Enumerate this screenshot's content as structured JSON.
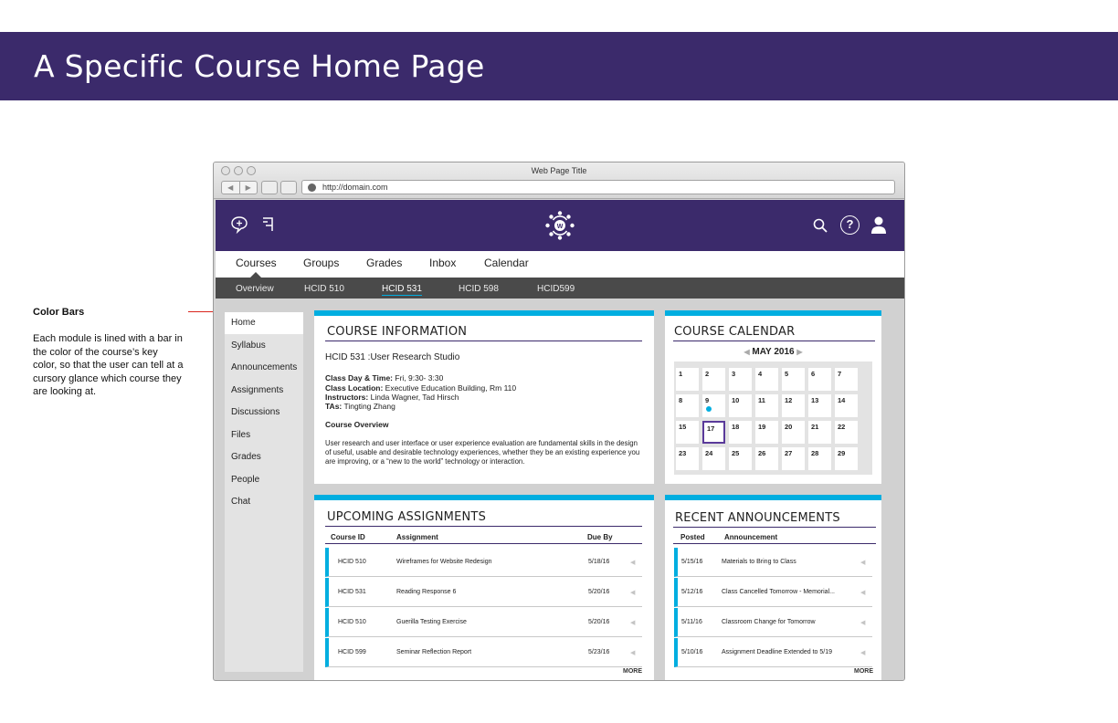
{
  "page_title": "A Specific Course Home Page",
  "annotation": {
    "title": "Color Bars",
    "body": "Each module is lined with a bar in the color of the course’s key color, so that the user can tell at a cursory glance which course they are looking at."
  },
  "browser": {
    "window_title": "Web Page Title",
    "url": "http://domain.com",
    "back_glyph": "◀",
    "forward_glyph": "▶"
  },
  "header": {
    "icons": [
      "chat-add-icon",
      "pin-icon",
      "logo-icon",
      "search-icon",
      "help-icon",
      "user-icon"
    ],
    "help_glyph": "?"
  },
  "main_nav": [
    "Courses",
    "Groups",
    "Grades",
    "Inbox",
    "Calendar"
  ],
  "sub_nav": [
    "Overview",
    "HCID 510",
    "HCID 531",
    "HCID 598",
    "HCID599"
  ],
  "sidebar": [
    "Home",
    "Syllabus",
    "Announcements",
    "Assignments",
    "Discussions",
    "Files",
    "Grades",
    "People",
    "Chat"
  ],
  "course_info": {
    "title": "COURSE INFORMATION",
    "course_name": "HCID 531 :User Research Studio",
    "day_time_label": "Class Day & Time:",
    "day_time": " Fri, 9:30- 3:30",
    "location_label": "Class Location:",
    "location": " Executive Education Building, Rm 110",
    "instructors_label": "Instructors:",
    "instructors": " Linda Wagner, Tad Hirsch",
    "tas_label": "TAs:",
    "tas": " Tingting Zhang",
    "overview_label": "Course Overview",
    "overview": "User research and user interface or user experience evaluation are fundamental skills in the design of useful, usable and desirable technology experiences, whether they be an existing experience you are improving, or a “new to the world” technology or interaction."
  },
  "calendar": {
    "title": "COURSE CALENDAR",
    "month": "MAY 2016",
    "prev": "◀",
    "next": "▶",
    "weeks": [
      [
        "1",
        "2",
        "3",
        "4",
        "5",
        "6",
        "7"
      ],
      [
        "8",
        "9",
        "10",
        "11",
        "12",
        "13",
        "14"
      ],
      [
        "15",
        "17",
        "18",
        "19",
        "20",
        "21",
        "22"
      ],
      [
        "23",
        "24",
        "25",
        "26",
        "27",
        "28",
        "29"
      ]
    ],
    "event_day": "9",
    "today": "17"
  },
  "assignments": {
    "title": "UPCOMING ASSIGNMENTS",
    "headers": [
      "Course ID",
      "Assignment",
      "Due By"
    ],
    "rows": [
      [
        "HCID 510",
        "Wireframes for Website Redesign",
        "5/18/16"
      ],
      [
        "HCID 531",
        "Reading Response 6",
        "5/20/16"
      ],
      [
        "HCID 510",
        "Guerilla Testing Exercise",
        "5/20/16"
      ],
      [
        "HCID 599",
        "Seminar Reflection Report",
        "5/23/16"
      ]
    ],
    "more": "MORE"
  },
  "announcements": {
    "title": "RECENT ANNOUNCEMENTS",
    "headers": [
      "Posted",
      "Announcement"
    ],
    "rows": [
      [
        "5/15/16",
        "Materials to Bring to Class"
      ],
      [
        "5/12/16",
        "Class Cancelled Tomorrow - Memorial..."
      ],
      [
        "5/11/16",
        "Classroom Change for Tomorrow"
      ],
      [
        "5/10/16",
        "Assignment Deadline Extended to 5/19"
      ]
    ],
    "more": "MORE"
  },
  "row_arrow": "◀",
  "colors": {
    "brand_purple": "#3b2a6b",
    "course_key": "#00aee0",
    "today_outline": "#5a3a9a"
  }
}
